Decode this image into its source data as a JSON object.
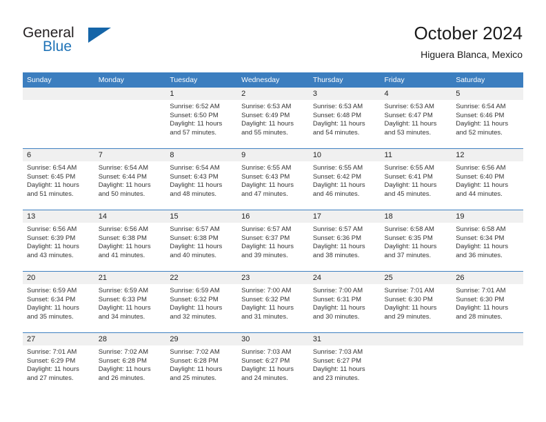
{
  "brand": {
    "name_part1": "General",
    "name_part2": "Blue",
    "triangle_color": "#1565a8",
    "blue_color": "#1f73b7"
  },
  "header": {
    "title": "October 2024",
    "subtitle": "Higuera Blanca, Mexico"
  },
  "theme": {
    "header_blue": "#3c7ebf",
    "daynum_band": "#f0f0f0",
    "cell_bg": "#ffffff",
    "text": "#333333"
  },
  "weekday_headers": [
    "Sunday",
    "Monday",
    "Tuesday",
    "Wednesday",
    "Thursday",
    "Friday",
    "Saturday"
  ],
  "weeks": [
    [
      {
        "day": "",
        "blank": true,
        "sunrise": "",
        "sunset": "",
        "daylight_line1": "",
        "daylight_line2": ""
      },
      {
        "day": "",
        "blank": true,
        "sunrise": "",
        "sunset": "",
        "daylight_line1": "",
        "daylight_line2": ""
      },
      {
        "day": "1",
        "sunrise": "Sunrise: 6:52 AM",
        "sunset": "Sunset: 6:50 PM",
        "daylight_line1": "Daylight: 11 hours",
        "daylight_line2": "and 57 minutes."
      },
      {
        "day": "2",
        "sunrise": "Sunrise: 6:53 AM",
        "sunset": "Sunset: 6:49 PM",
        "daylight_line1": "Daylight: 11 hours",
        "daylight_line2": "and 55 minutes."
      },
      {
        "day": "3",
        "sunrise": "Sunrise: 6:53 AM",
        "sunset": "Sunset: 6:48 PM",
        "daylight_line1": "Daylight: 11 hours",
        "daylight_line2": "and 54 minutes."
      },
      {
        "day": "4",
        "sunrise": "Sunrise: 6:53 AM",
        "sunset": "Sunset: 6:47 PM",
        "daylight_line1": "Daylight: 11 hours",
        "daylight_line2": "and 53 minutes."
      },
      {
        "day": "5",
        "sunrise": "Sunrise: 6:54 AM",
        "sunset": "Sunset: 6:46 PM",
        "daylight_line1": "Daylight: 11 hours",
        "daylight_line2": "and 52 minutes."
      }
    ],
    [
      {
        "day": "6",
        "sunrise": "Sunrise: 6:54 AM",
        "sunset": "Sunset: 6:45 PM",
        "daylight_line1": "Daylight: 11 hours",
        "daylight_line2": "and 51 minutes."
      },
      {
        "day": "7",
        "sunrise": "Sunrise: 6:54 AM",
        "sunset": "Sunset: 6:44 PM",
        "daylight_line1": "Daylight: 11 hours",
        "daylight_line2": "and 50 minutes."
      },
      {
        "day": "8",
        "sunrise": "Sunrise: 6:54 AM",
        "sunset": "Sunset: 6:43 PM",
        "daylight_line1": "Daylight: 11 hours",
        "daylight_line2": "and 48 minutes."
      },
      {
        "day": "9",
        "sunrise": "Sunrise: 6:55 AM",
        "sunset": "Sunset: 6:43 PM",
        "daylight_line1": "Daylight: 11 hours",
        "daylight_line2": "and 47 minutes."
      },
      {
        "day": "10",
        "sunrise": "Sunrise: 6:55 AM",
        "sunset": "Sunset: 6:42 PM",
        "daylight_line1": "Daylight: 11 hours",
        "daylight_line2": "and 46 minutes."
      },
      {
        "day": "11",
        "sunrise": "Sunrise: 6:55 AM",
        "sunset": "Sunset: 6:41 PM",
        "daylight_line1": "Daylight: 11 hours",
        "daylight_line2": "and 45 minutes."
      },
      {
        "day": "12",
        "sunrise": "Sunrise: 6:56 AM",
        "sunset": "Sunset: 6:40 PM",
        "daylight_line1": "Daylight: 11 hours",
        "daylight_line2": "and 44 minutes."
      }
    ],
    [
      {
        "day": "13",
        "sunrise": "Sunrise: 6:56 AM",
        "sunset": "Sunset: 6:39 PM",
        "daylight_line1": "Daylight: 11 hours",
        "daylight_line2": "and 43 minutes."
      },
      {
        "day": "14",
        "sunrise": "Sunrise: 6:56 AM",
        "sunset": "Sunset: 6:38 PM",
        "daylight_line1": "Daylight: 11 hours",
        "daylight_line2": "and 41 minutes."
      },
      {
        "day": "15",
        "sunrise": "Sunrise: 6:57 AM",
        "sunset": "Sunset: 6:38 PM",
        "daylight_line1": "Daylight: 11 hours",
        "daylight_line2": "and 40 minutes."
      },
      {
        "day": "16",
        "sunrise": "Sunrise: 6:57 AM",
        "sunset": "Sunset: 6:37 PM",
        "daylight_line1": "Daylight: 11 hours",
        "daylight_line2": "and 39 minutes."
      },
      {
        "day": "17",
        "sunrise": "Sunrise: 6:57 AM",
        "sunset": "Sunset: 6:36 PM",
        "daylight_line1": "Daylight: 11 hours",
        "daylight_line2": "and 38 minutes."
      },
      {
        "day": "18",
        "sunrise": "Sunrise: 6:58 AM",
        "sunset": "Sunset: 6:35 PM",
        "daylight_line1": "Daylight: 11 hours",
        "daylight_line2": "and 37 minutes."
      },
      {
        "day": "19",
        "sunrise": "Sunrise: 6:58 AM",
        "sunset": "Sunset: 6:34 PM",
        "daylight_line1": "Daylight: 11 hours",
        "daylight_line2": "and 36 minutes."
      }
    ],
    [
      {
        "day": "20",
        "sunrise": "Sunrise: 6:59 AM",
        "sunset": "Sunset: 6:34 PM",
        "daylight_line1": "Daylight: 11 hours",
        "daylight_line2": "and 35 minutes."
      },
      {
        "day": "21",
        "sunrise": "Sunrise: 6:59 AM",
        "sunset": "Sunset: 6:33 PM",
        "daylight_line1": "Daylight: 11 hours",
        "daylight_line2": "and 34 minutes."
      },
      {
        "day": "22",
        "sunrise": "Sunrise: 6:59 AM",
        "sunset": "Sunset: 6:32 PM",
        "daylight_line1": "Daylight: 11 hours",
        "daylight_line2": "and 32 minutes."
      },
      {
        "day": "23",
        "sunrise": "Sunrise: 7:00 AM",
        "sunset": "Sunset: 6:32 PM",
        "daylight_line1": "Daylight: 11 hours",
        "daylight_line2": "and 31 minutes."
      },
      {
        "day": "24",
        "sunrise": "Sunrise: 7:00 AM",
        "sunset": "Sunset: 6:31 PM",
        "daylight_line1": "Daylight: 11 hours",
        "daylight_line2": "and 30 minutes."
      },
      {
        "day": "25",
        "sunrise": "Sunrise: 7:01 AM",
        "sunset": "Sunset: 6:30 PM",
        "daylight_line1": "Daylight: 11 hours",
        "daylight_line2": "and 29 minutes."
      },
      {
        "day": "26",
        "sunrise": "Sunrise: 7:01 AM",
        "sunset": "Sunset: 6:30 PM",
        "daylight_line1": "Daylight: 11 hours",
        "daylight_line2": "and 28 minutes."
      }
    ],
    [
      {
        "day": "27",
        "sunrise": "Sunrise: 7:01 AM",
        "sunset": "Sunset: 6:29 PM",
        "daylight_line1": "Daylight: 11 hours",
        "daylight_line2": "and 27 minutes."
      },
      {
        "day": "28",
        "sunrise": "Sunrise: 7:02 AM",
        "sunset": "Sunset: 6:28 PM",
        "daylight_line1": "Daylight: 11 hours",
        "daylight_line2": "and 26 minutes."
      },
      {
        "day": "29",
        "sunrise": "Sunrise: 7:02 AM",
        "sunset": "Sunset: 6:28 PM",
        "daylight_line1": "Daylight: 11 hours",
        "daylight_line2": "and 25 minutes."
      },
      {
        "day": "30",
        "sunrise": "Sunrise: 7:03 AM",
        "sunset": "Sunset: 6:27 PM",
        "daylight_line1": "Daylight: 11 hours",
        "daylight_line2": "and 24 minutes."
      },
      {
        "day": "31",
        "sunrise": "Sunrise: 7:03 AM",
        "sunset": "Sunset: 6:27 PM",
        "daylight_line1": "Daylight: 11 hours",
        "daylight_line2": "and 23 minutes."
      },
      {
        "day": "",
        "blank": true,
        "sunrise": "",
        "sunset": "",
        "daylight_line1": "",
        "daylight_line2": ""
      },
      {
        "day": "",
        "blank": true,
        "sunrise": "",
        "sunset": "",
        "daylight_line1": "",
        "daylight_line2": ""
      }
    ]
  ]
}
